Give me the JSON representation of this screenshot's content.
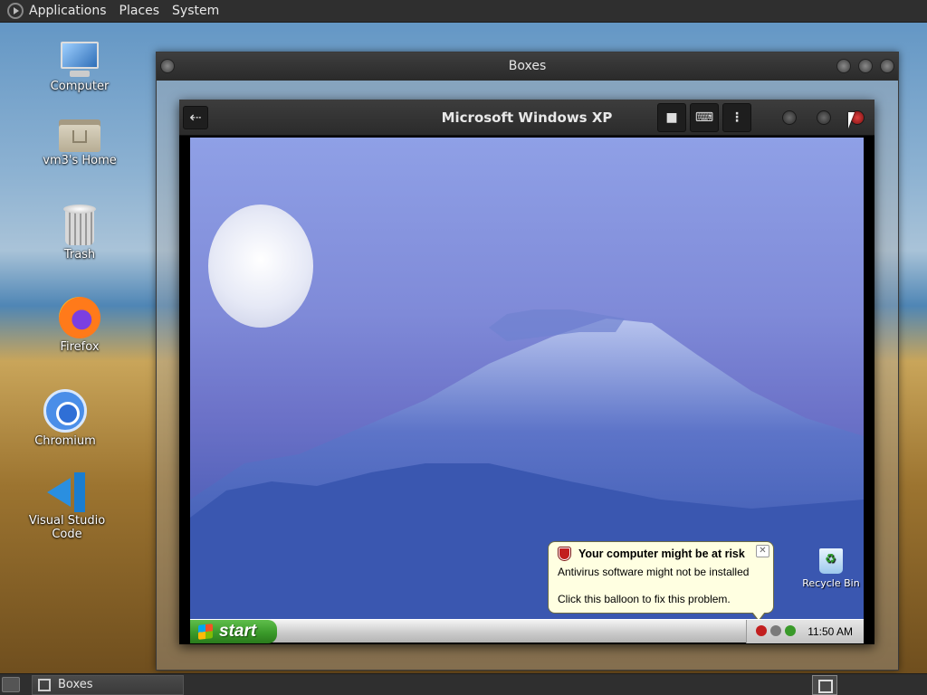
{
  "top_panel": {
    "menus": [
      "Applications",
      "Places",
      "System"
    ]
  },
  "desktop": {
    "icons": [
      {
        "label": "Computer",
        "icon": "computer-icon"
      },
      {
        "label": "vm3's Home",
        "icon": "home-folder-icon"
      },
      {
        "label": "Trash",
        "icon": "trash-icon"
      },
      {
        "label": "Firefox",
        "icon": "firefox-icon"
      },
      {
        "label": "Chromium",
        "icon": "chromium-icon"
      },
      {
        "label": "Visual Studio Code",
        "icon": "vscode-icon"
      }
    ]
  },
  "boxes_window": {
    "title": "Boxes"
  },
  "vm_window": {
    "title": "Microsoft Windows XP",
    "back_icon": "back-arrow-icon",
    "toolbar_icons": [
      "stop-icon",
      "keyboard-icon",
      "menu-dots-icon"
    ],
    "back_glyph": "⇠",
    "stop_glyph": "■",
    "keyboard_glyph": "⌨",
    "menu_glyph": "⋮"
  },
  "xp": {
    "start_label": "start",
    "clock": "11:50 AM",
    "recycle_bin_label": "Recycle Bin",
    "balloon": {
      "title": "Your computer might be at risk",
      "line1": "Antivirus software might not be installed",
      "line2": "Click this balloon to fix this problem.",
      "close_glyph": "✕"
    }
  },
  "bottom_panel": {
    "task_label": "Boxes"
  }
}
